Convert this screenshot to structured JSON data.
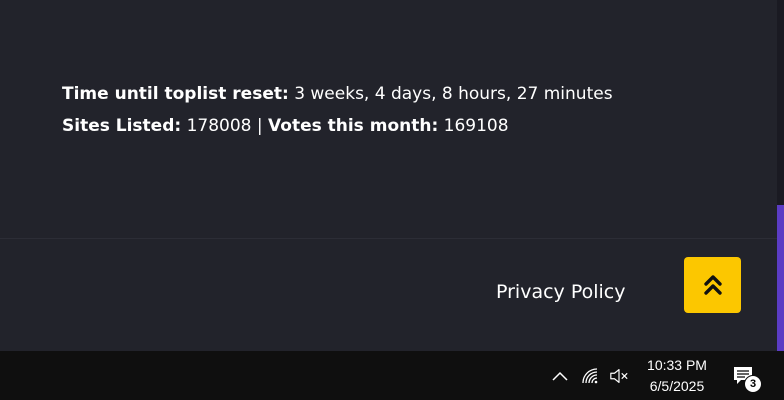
{
  "stats": {
    "reset_label": "Time until toplist reset:",
    "reset_value": "3 weeks, 4 days, 8 hours, 27 minutes",
    "sites_label": "Sites Listed:",
    "sites_value": "178008",
    "separator": "|",
    "votes_label": "Votes this month:",
    "votes_value": "169108"
  },
  "footer": {
    "privacy_link": "Privacy Policy",
    "scroll_top_icon": "double-chevron-up-icon"
  },
  "colors": {
    "background": "#22232b",
    "accent": "#fcc700",
    "scrollbar_thumb": "#5b3cc4",
    "taskbar": "#0f0f0f"
  },
  "taskbar": {
    "icons": [
      "chevron-up-icon",
      "wifi-icon",
      "volume-muted-icon"
    ],
    "time": "10:33 PM",
    "date": "6/5/2025",
    "notification_count": "3"
  }
}
